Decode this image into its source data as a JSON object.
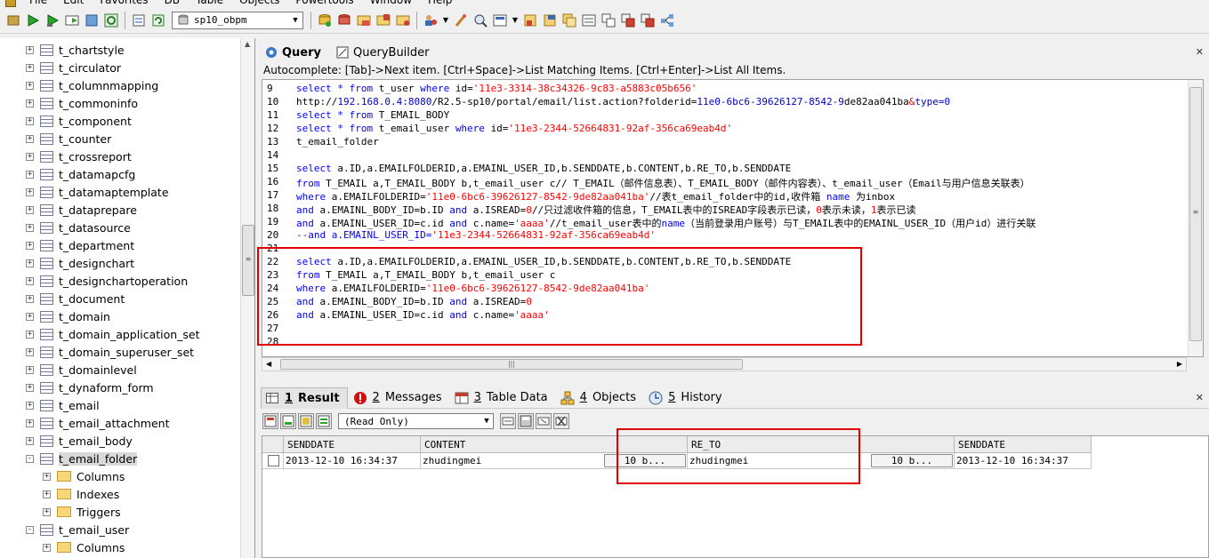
{
  "menubar": {
    "items": [
      "File",
      "Edit",
      "Favorites",
      "DB",
      "Table",
      "Objects",
      "Powertools",
      "Window",
      "Help"
    ]
  },
  "toolbar": {
    "database_value": "sp10_obpm"
  },
  "tree": {
    "nodes": [
      {
        "label": "t_chartstyle",
        "kind": "table",
        "expander": "+"
      },
      {
        "label": "t_circulator",
        "kind": "table",
        "expander": "+"
      },
      {
        "label": "t_columnmapping",
        "kind": "table",
        "expander": "+"
      },
      {
        "label": "t_commoninfo",
        "kind": "table",
        "expander": "+"
      },
      {
        "label": "t_component",
        "kind": "table",
        "expander": "+"
      },
      {
        "label": "t_counter",
        "kind": "table",
        "expander": "+"
      },
      {
        "label": "t_crossreport",
        "kind": "table",
        "expander": "+"
      },
      {
        "label": "t_datamapcfg",
        "kind": "table",
        "expander": "+"
      },
      {
        "label": "t_datamaptemplate",
        "kind": "table",
        "expander": "+"
      },
      {
        "label": "t_dataprepare",
        "kind": "table",
        "expander": "+"
      },
      {
        "label": "t_datasource",
        "kind": "table",
        "expander": "+"
      },
      {
        "label": "t_department",
        "kind": "table",
        "expander": "+"
      },
      {
        "label": "t_designchart",
        "kind": "table",
        "expander": "+"
      },
      {
        "label": "t_designchartoperation",
        "kind": "table",
        "expander": "+"
      },
      {
        "label": "t_document",
        "kind": "table",
        "expander": "+"
      },
      {
        "label": "t_domain",
        "kind": "table",
        "expander": "+"
      },
      {
        "label": "t_domain_application_set",
        "kind": "table",
        "expander": "+"
      },
      {
        "label": "t_domain_superuser_set",
        "kind": "table",
        "expander": "+"
      },
      {
        "label": "t_domainlevel",
        "kind": "table",
        "expander": "+"
      },
      {
        "label": "t_dynaform_form",
        "kind": "table",
        "expander": "+"
      },
      {
        "label": "t_email",
        "kind": "table",
        "expander": "+"
      },
      {
        "label": "t_email_attachment",
        "kind": "table",
        "expander": "+"
      },
      {
        "label": "t_email_body",
        "kind": "table",
        "expander": "+"
      },
      {
        "label": "t_email_folder",
        "kind": "table",
        "expander": "-",
        "selected": true
      },
      {
        "label": "Columns",
        "kind": "folder",
        "expander": "+",
        "child": true
      },
      {
        "label": "Indexes",
        "kind": "folder",
        "expander": "+",
        "child": true
      },
      {
        "label": "Triggers",
        "kind": "folder",
        "expander": "+",
        "child": true
      },
      {
        "label": "t_email_user",
        "kind": "table",
        "expander": "-"
      },
      {
        "label": "Columns",
        "kind": "folder",
        "expander": "+",
        "child": true
      }
    ]
  },
  "query_tabs": [
    {
      "label": "Query",
      "active": true,
      "icon": "query-icon"
    },
    {
      "label": "QueryBuilder",
      "active": false,
      "icon": "querybuilder-icon"
    }
  ],
  "autocomplete_hint": "Autocomplete: [Tab]->Next item. [Ctrl+Space]->List Matching Items. [Ctrl+Enter]->List All Items.",
  "editor": {
    "lines": [
      {
        "n": "9",
        "t": [
          {
            "c": "kw",
            "s": "select * from "
          },
          {
            "s": "t_user "
          },
          {
            "c": "kw",
            "s": "where "
          },
          {
            "s": "id="
          },
          {
            "c": "str",
            "s": "'11e3-3314-38c34326-9c83-a5883c05b656'"
          }
        ]
      },
      {
        "n": "10",
        "t": [
          {
            "s": "http://"
          },
          {
            "c": "url",
            "s": "192.168.0.4:8080"
          },
          {
            "s": "/R2.5-sp10/portal/email/list.action?folderid="
          },
          {
            "c": "url",
            "s": "11e0-6bc6-39626127-8542-9"
          },
          {
            "s": "de82aa041ba"
          },
          {
            "c": "str",
            "s": "&"
          },
          {
            "c": "url",
            "s": "type=0"
          }
        ]
      },
      {
        "n": "11",
        "t": [
          {
            "c": "kw",
            "s": "select * from "
          },
          {
            "s": "T_EMAIL_BODY"
          }
        ]
      },
      {
        "n": "12",
        "t": [
          {
            "c": "kw",
            "s": "select * from "
          },
          {
            "s": "t_email_user "
          },
          {
            "c": "kw",
            "s": "where "
          },
          {
            "s": "id="
          },
          {
            "c": "str",
            "s": "'11e3-2344-52664831-92af-356ca69eab4d'"
          }
        ]
      },
      {
        "n": "13",
        "t": [
          {
            "s": "t_email_folder"
          }
        ]
      },
      {
        "n": "14",
        "t": []
      },
      {
        "n": "15",
        "t": [
          {
            "c": "kw",
            "s": "select "
          },
          {
            "s": "a.ID,a.EMAILFOLDERID,a.EMAINL_USER_ID,b.SENDDATE,b.CONTENT,b.RE_TO,b.SENDDATE"
          }
        ]
      },
      {
        "n": "16",
        "t": [
          {
            "c": "kw",
            "s": "from "
          },
          {
            "s": "T_EMAIL a,T_EMAIL_BODY b,t_email_user c// T_EMAIL（邮件信息表）、T_EMAIL_BODY（邮件内容表）、t_email_user（Email与用户信息关联表）"
          }
        ]
      },
      {
        "n": "17",
        "t": [
          {
            "c": "kw",
            "s": "where "
          },
          {
            "s": "a.EMAILFOLDERID="
          },
          {
            "c": "str",
            "s": "'11e0-6bc6-39626127-8542-9de82aa041ba'"
          },
          {
            "s": "//表t_email_folder中的id,收件箱 "
          },
          {
            "c": "kw",
            "s": "name "
          },
          {
            "s": "为inbox"
          }
        ]
      },
      {
        "n": "18",
        "t": [
          {
            "c": "kw",
            "s": "and "
          },
          {
            "s": "a.EMAINL_BODY_ID=b.ID "
          },
          {
            "c": "kw",
            "s": "and "
          },
          {
            "s": "a.ISREAD="
          },
          {
            "c": "str",
            "s": "0"
          },
          {
            "s": "//只过滤收件箱的信息，T_EMAIL表中的ISREAD字段表示已读，"
          },
          {
            "c": "str",
            "s": "0"
          },
          {
            "s": "表示未读，"
          },
          {
            "c": "str",
            "s": "1"
          },
          {
            "s": "表示已读"
          }
        ]
      },
      {
        "n": "19",
        "t": [
          {
            "c": "kw",
            "s": "and "
          },
          {
            "s": "a.EMAINL_USER_ID=c.id "
          },
          {
            "c": "kw",
            "s": "and "
          },
          {
            "s": "c.name="
          },
          {
            "c": "str",
            "s": "'aaaa'"
          },
          {
            "s": "//t_email_user表中的"
          },
          {
            "c": "kw",
            "s": "name"
          },
          {
            "s": "（当前登录用户账号）与T_EMAIL表中的EMAINL_USER_ID（用户id）进行关联"
          }
        ]
      },
      {
        "n": "20",
        "t": [
          {
            "c": "kw",
            "s": "--and a.EMAINL_USER_ID="
          },
          {
            "c": "str",
            "s": "'11e3-2344-52664831-92af-356ca69eab4d'"
          }
        ]
      },
      {
        "n": "21",
        "t": []
      },
      {
        "n": "22",
        "t": [
          {
            "c": "kw",
            "s": "select "
          },
          {
            "s": "a.ID,a.EMAILFOLDERID,a.EMAINL_USER_ID,b.SENDDATE,b.CONTENT,b.RE_TO,b.SENDDATE"
          }
        ]
      },
      {
        "n": "23",
        "t": [
          {
            "c": "kw",
            "s": "from "
          },
          {
            "s": "T_EMAIL a,T_EMAIL_BODY b,t_email_user c"
          }
        ]
      },
      {
        "n": "24",
        "t": [
          {
            "c": "kw",
            "s": "where "
          },
          {
            "s": "a.EMAILFOLDERID="
          },
          {
            "c": "str",
            "s": "'11e0-6bc6-39626127-8542-9de82aa041ba'"
          }
        ]
      },
      {
        "n": "25",
        "t": [
          {
            "c": "kw",
            "s": "and "
          },
          {
            "s": "a.EMAINL_BODY_ID=b.ID "
          },
          {
            "c": "kw",
            "s": "and "
          },
          {
            "s": "a.ISREAD="
          },
          {
            "c": "str",
            "s": "0"
          }
        ]
      },
      {
        "n": "26",
        "t": [
          {
            "c": "kw",
            "s": "and "
          },
          {
            "s": "a.EMAINL_USER_ID=c.id "
          },
          {
            "c": "kw",
            "s": "and "
          },
          {
            "s": "c.name="
          },
          {
            "c": "str",
            "s": "'aaaa'"
          }
        ]
      },
      {
        "n": "27",
        "t": []
      },
      {
        "n": "28",
        "t": []
      }
    ]
  },
  "result_tabs": [
    {
      "num": "1",
      "label": "Result",
      "active": true,
      "icon": "result-grid-icon"
    },
    {
      "num": "2",
      "label": "Messages",
      "active": false,
      "icon": "messages-icon"
    },
    {
      "num": "3",
      "label": "Table Data",
      "active": false,
      "icon": "table-data-icon"
    },
    {
      "num": "4",
      "label": "Objects",
      "active": false,
      "icon": "objects-icon"
    },
    {
      "num": "5",
      "label": "History",
      "active": false,
      "icon": "history-icon"
    }
  ],
  "result_toolbar": {
    "mode_value": "(Read Only)"
  },
  "grid": {
    "headers": [
      "SENDDATE",
      "CONTENT",
      "",
      "RE_TO",
      "",
      "SENDDATE"
    ],
    "row": {
      "senddate1": "2013-12-10 16:34:37",
      "content": "zhudingmei",
      "content_blob": "10 b...",
      "re_to": "zhudingmei",
      "re_to_blob": "10 b...",
      "senddate2": "2013-12-10 16:34:37"
    }
  },
  "colors": {
    "highlight_box": "#e00000",
    "keyword": "#0000ff",
    "string": "#ff0000"
  }
}
